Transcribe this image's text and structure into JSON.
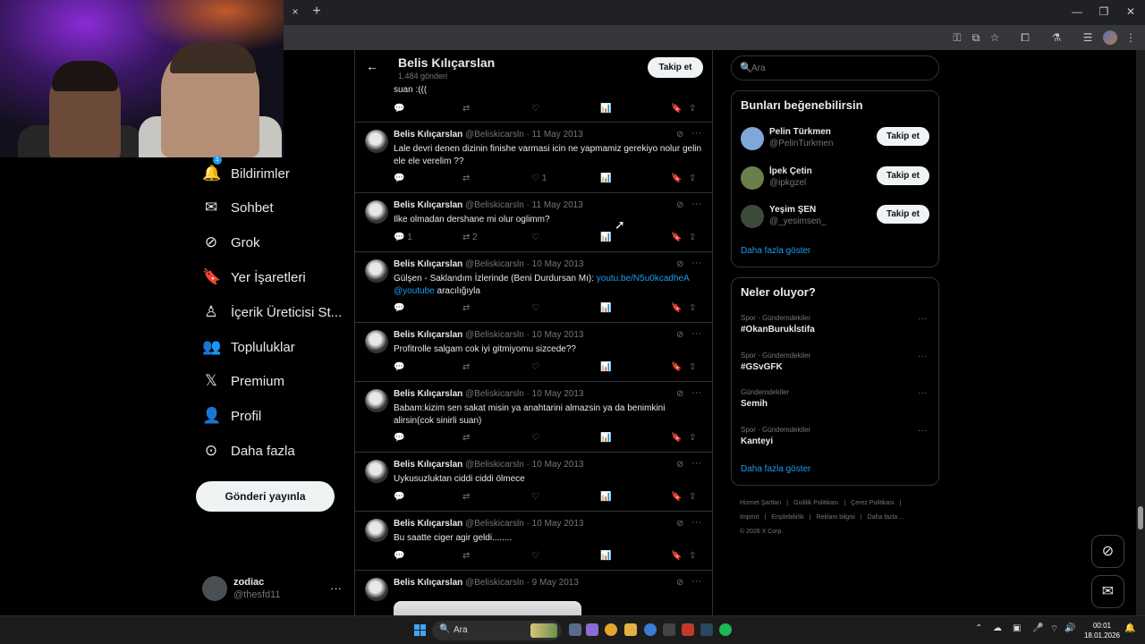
{
  "browser": {
    "tab_close": "×",
    "new_tab": "+",
    "window_controls": [
      "—",
      "❐",
      "✕"
    ]
  },
  "nav": {
    "items": [
      {
        "label": "Bildirimler",
        "icon": "bell-icon",
        "glyph": "🔔",
        "badge": "1"
      },
      {
        "label": "Sohbet",
        "icon": "mail-icon",
        "glyph": "✉"
      },
      {
        "label": "Grok",
        "icon": "grok-icon",
        "glyph": "⊘"
      },
      {
        "label": "Yer İşaretleri",
        "icon": "bookmark-icon",
        "glyph": "🔖"
      },
      {
        "label": "İçerik Üreticisi St...",
        "icon": "creator-studio-icon",
        "glyph": "♙"
      },
      {
        "label": "Topluluklar",
        "icon": "communities-icon",
        "glyph": "👥"
      },
      {
        "label": "Premium",
        "icon": "x-logo-icon",
        "glyph": "𝕏"
      },
      {
        "label": "Profil",
        "icon": "profile-icon",
        "glyph": "👤"
      },
      {
        "label": "Daha fazla",
        "icon": "more-circle-icon",
        "glyph": "⊙"
      }
    ],
    "post_button": "Gönderi yayınla",
    "account": {
      "name": "zodiac",
      "handle": "@thesfd11",
      "more": "···"
    }
  },
  "header": {
    "back": "←",
    "name": "Belis Kılıçarslan",
    "post_count": "1.484 gönderi",
    "follow": "Takip et"
  },
  "partial_tweet": {
    "text": "suan :((("
  },
  "tweets": [
    {
      "name": "Belis Kılıçarslan",
      "handle": "@Beliskicarsln",
      "date": "11 May 2013",
      "text": "Lale devri denen dizinin finishe varmasi icin ne yapmamiz gerekiyo nolur gelin ele ele verelim ??",
      "replies": "",
      "retweets": "",
      "likes": "1"
    },
    {
      "name": "Belis Kılıçarslan",
      "handle": "@Beliskicarsln",
      "date": "11 May 2013",
      "text": "Ilke olmadan dershane mi olur oglimm?",
      "replies": "1",
      "retweets": "2",
      "likes": ""
    },
    {
      "name": "Belis Kılıçarslan",
      "handle": "@Beliskicarsln",
      "date": "10 May 2013",
      "text_pre": "Gülşen - Saklandım İzlerinde (Beni Durdursan Mı): ",
      "link": "youtu.be/N5u0kcadheA",
      "mention": "@youtube",
      "text_post": " aracılığıyla",
      "replies": "",
      "retweets": "",
      "likes": ""
    },
    {
      "name": "Belis Kılıçarslan",
      "handle": "@Beliskicarsln",
      "date": "10 May 2013",
      "text": "Profitrolle salgam cok iyi gitmiyomu sizcede??",
      "replies": "",
      "retweets": "",
      "likes": ""
    },
    {
      "name": "Belis Kılıçarslan",
      "handle": "@Beliskicarsln",
      "date": "10 May 2013",
      "text": "Babam:kizim sen sakat misin ya anahtarini almazsin ya da benimkini alirsin(cok sinirli suan)",
      "replies": "",
      "retweets": "",
      "likes": ""
    },
    {
      "name": "Belis Kılıçarslan",
      "handle": "@Beliskicarsln",
      "date": "10 May 2013",
      "text": "Uykusuzluktan ciddi ciddi ölmece",
      "replies": "",
      "retweets": "",
      "likes": ""
    },
    {
      "name": "Belis Kılıçarslan",
      "handle": "@Beliskicarsln",
      "date": "10 May 2013",
      "text": "Bu saatte ciger agir geldi........",
      "replies": "",
      "retweets": "",
      "likes": ""
    },
    {
      "name": "Belis Kılıçarslan",
      "handle": "@Beliskicarsln",
      "date": "9 May 2013",
      "text": "",
      "replies": "",
      "retweets": "",
      "likes": ""
    }
  ],
  "action_glyphs": {
    "reply": "💬",
    "retweet": "⇄",
    "like": "♡",
    "views": "📊",
    "bookmark": "🔖",
    "share": "⇪",
    "grok": "⊘",
    "more": "···"
  },
  "search": {
    "placeholder": "Ara",
    "icon": "🔍"
  },
  "suggestions": {
    "title": "Bunları beğenebilirsin",
    "users": [
      {
        "name": "Pelin Türkmen",
        "handle": "@PelinTurkmen",
        "button": "Takip et",
        "color": "#7fa8d8"
      },
      {
        "name": "İpek Çetin",
        "handle": "@ipkgzel",
        "button": "Takip et",
        "color": "#6b7f4a"
      },
      {
        "name": "Yeşim ŞEN",
        "handle": "@_yesimsen_",
        "button": "Takip et",
        "color": "#3d4a3a"
      }
    ],
    "more": "Daha fazla göster"
  },
  "trends": {
    "title": "Neler oluyor?",
    "items": [
      {
        "category": "Spor · Gündemdekiler",
        "topic": "#OkanBurukİstifa"
      },
      {
        "category": "Spor · Gündemdekiler",
        "topic": "#GSvGFK"
      },
      {
        "category": "Gündemdekiler",
        "topic": "Semih"
      },
      {
        "category": "Spor · Gündemdekiler",
        "topic": "Kanteyi"
      }
    ],
    "more": "Daha fazla göster"
  },
  "footer": {
    "line1": [
      "Hizmet Şartları",
      "|",
      "Gizlilik Politikası",
      "|",
      "Çerez Politikası",
      "|"
    ],
    "line2": [
      "Imprint",
      "|",
      "Erişilebilirlik",
      "|",
      "Reklam bilgisi",
      "|",
      "Daha fazla ..."
    ],
    "copyright": "© 2026 X Corp."
  },
  "fabs": {
    "grok": "⊘",
    "messages": "✉"
  },
  "taskbar": {
    "search_label": "Ara",
    "search_icon": "🔍",
    "time": "00:01",
    "date": "18.01.2026"
  }
}
